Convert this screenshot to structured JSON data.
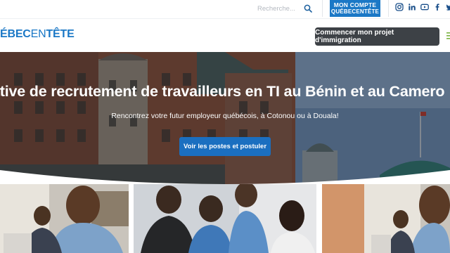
{
  "topbar": {
    "search_placeholder": "Recherche...",
    "account_line1": "MON COMPTE",
    "account_line2": "QUÉBECENTÊTE",
    "socials": [
      {
        "name": "instagram-icon"
      },
      {
        "name": "linkedin-icon"
      },
      {
        "name": "youtube-icon"
      },
      {
        "name": "facebook-icon"
      },
      {
        "name": "twitter-icon"
      }
    ]
  },
  "header": {
    "logo_part1": "ÉBEC",
    "logo_part2": "EN",
    "logo_part3": "TÊTE",
    "cta_label": "Commencer mon projet d'immigration"
  },
  "hero": {
    "title": "ative de recrutement de travailleurs en TI au Bénin et au Camero",
    "subtitle": "Rencontrez votre futur employeur québécois, à Cotonou ou à Douala!",
    "button_label": "Voir les postes et postuler"
  },
  "colors": {
    "brand_blue": "#1b78c6",
    "button_dark": "#3d4146",
    "hero_button": "#1b6fc0"
  }
}
